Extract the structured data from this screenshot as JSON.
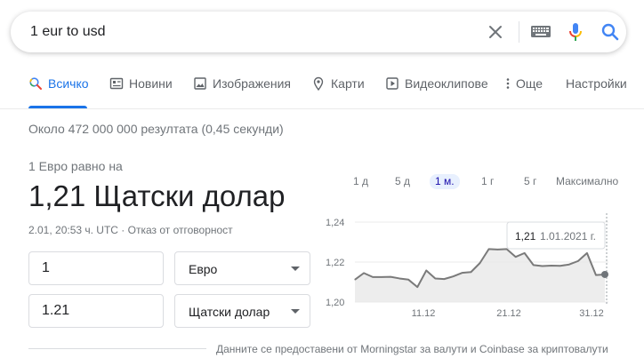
{
  "search": {
    "query": "1 eur to usd"
  },
  "tabs": [
    {
      "label": "Всичко",
      "icon": "search-icon",
      "active": true
    },
    {
      "label": "Новини",
      "icon": "news-icon"
    },
    {
      "label": "Изображения",
      "icon": "image-icon"
    },
    {
      "label": "Карти",
      "icon": "map-pin-icon"
    },
    {
      "label": "Видеоклипове",
      "icon": "play-icon"
    },
    {
      "label": "Още",
      "icon": "more-vert-icon"
    },
    {
      "label": "Настройки"
    }
  ],
  "result_stats": "Около 472 000 000 резултата (0,45 секунди)",
  "converter": {
    "label": "1 Евро равно на",
    "value": "1,21 Щатски долар",
    "timestamp": "2.01, 20:53 ч. UTC",
    "separator": " · ",
    "disclaimer": "Отказ от отговорност",
    "from_amount": "1",
    "from_currency": "Евро",
    "to_amount": "1.21",
    "to_currency": "Щатски долар"
  },
  "ranges": [
    "1 д",
    "5 д",
    "1 м.",
    "1 г",
    "5 г",
    "Максимално"
  ],
  "active_range": "1 м.",
  "colors": {
    "accent": "#1a73e8",
    "line": "#7a7a7a",
    "fill": "#e8e8e8",
    "mic_blue": "#4285f4",
    "mic_red": "#ea4335",
    "mic_yellow": "#fbbc04",
    "mic_green": "#34a853"
  },
  "chart_data": {
    "type": "area",
    "ylim": [
      1.2,
      1.24
    ],
    "y_ticks": [
      "1,24",
      "1,22",
      "1,20"
    ],
    "x_ticks": [
      "11.12",
      "21.12",
      "31.12"
    ],
    "y": [
      1.2112,
      1.2145,
      1.2125,
      1.2125,
      1.2126,
      1.2118,
      1.2112,
      1.2075,
      1.2158,
      1.2118,
      1.2115,
      1.2128,
      1.2146,
      1.215,
      1.2195,
      1.2265,
      1.2263,
      1.2265,
      1.2226,
      1.2245,
      1.2185,
      1.218,
      1.2182,
      1.2181,
      1.2188,
      1.2205,
      1.2245,
      1.2135,
      1.2138
    ],
    "tooltip": {
      "value": "1,21",
      "date": "1.01.2021 г."
    }
  },
  "source": "Данните се предоставени от Morningstar за валути и Coinbase за криптовалути"
}
